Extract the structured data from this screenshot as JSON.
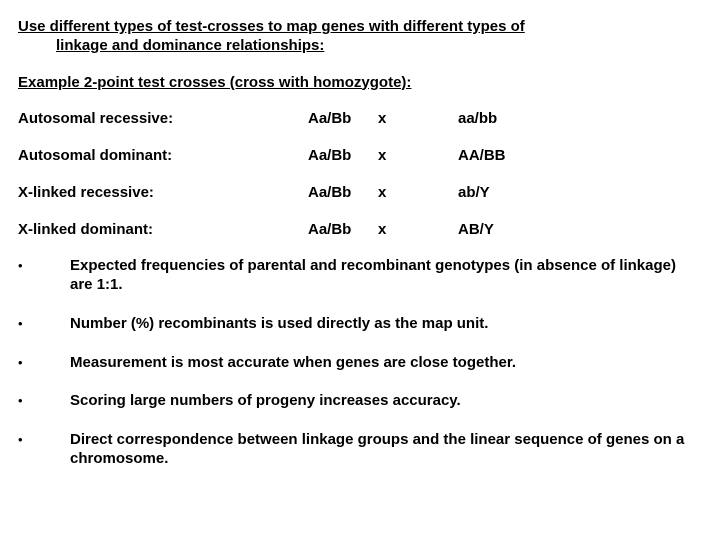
{
  "heading_line1": "Use different types of test-crosses to map genes with different types of",
  "heading_line2": "linkage and dominance relationships:",
  "subhead": "Example 2-point test crosses (cross with homozygote):",
  "rows": [
    {
      "label": "Autosomal recessive:",
      "p1": "Aa/Bb",
      "x": "x",
      "p2": "aa/bb"
    },
    {
      "label": "Autosomal dominant:",
      "p1": "Aa/Bb",
      "x": "x",
      "p2": "AA/BB"
    },
    {
      "label": "X-linked recessive:",
      "p1": "Aa/Bb",
      "x": "x",
      "p2": "ab/Y"
    },
    {
      "label": "X-linked dominant:",
      "p1": "Aa/Bb",
      "x": "x",
      "p2": "AB/Y"
    }
  ],
  "bullets": [
    "Expected frequencies of parental and recombinant genotypes (in absence of linkage) are 1:1.",
    "Number (%) recombinants is used directly as the map unit.",
    "Measurement is most accurate when genes are close together.",
    "Scoring large numbers of progeny increases accuracy.",
    "Direct correspondence between linkage groups and the linear sequence of genes on a chromosome."
  ],
  "bullet_char": "•"
}
